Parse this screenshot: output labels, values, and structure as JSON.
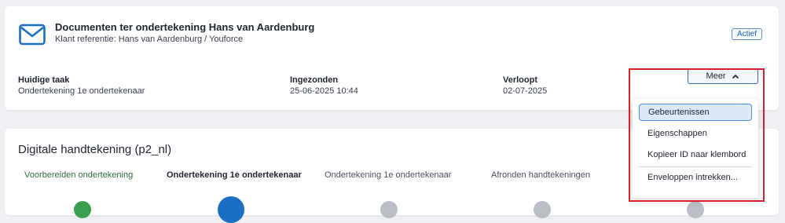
{
  "header": {
    "title": "Documenten ter ondertekening Hans van Aardenburg",
    "subtitle": "Klant referentie: Hans van Aardenburg / Youforce",
    "status": "Actief",
    "icon": "envelope-icon"
  },
  "meta": {
    "current_task_label": "Huidige taak",
    "current_task_value": "Ondertekening 1e ondertekenaar",
    "submitted_label": "Ingezonden",
    "submitted_value": "25-06-2025 10:44",
    "expires_label": "Verloopt",
    "expires_value": "02-07-2025"
  },
  "actions": {
    "more_label": "Meer",
    "menu": [
      {
        "label": "Gebeurtenissen",
        "active": true
      },
      {
        "label": "Eigenschappen",
        "active": false
      },
      {
        "label": "Kopieer ID naar klembord",
        "active": false
      },
      {
        "label": "Enveloppen intrekken...",
        "active": false
      }
    ]
  },
  "signing": {
    "title": "Digitale handtekening (p2_nl)",
    "steps": [
      {
        "label": "Voorbereiden ondertekening",
        "state": "done"
      },
      {
        "label": "Ondertekening 1e ondertekenaar",
        "state": "current"
      },
      {
        "label": "Ondertekening 1e ondertekenaar",
        "state": "pending"
      },
      {
        "label": "Afronden handtekeningen",
        "state": "pending"
      }
    ]
  },
  "colors": {
    "accent": "#1b6fc4",
    "done": "#3aa04f",
    "pending": "#b9bdc4",
    "highlight": "#e01e2a"
  }
}
